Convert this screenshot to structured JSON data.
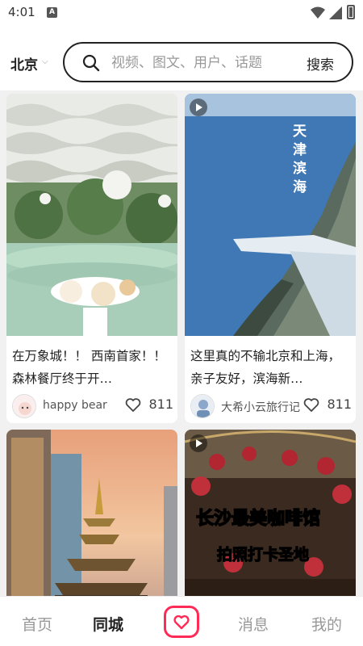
{
  "status_bar": {
    "time": "4:01",
    "notif_icon_letter": "A"
  },
  "header": {
    "city": "北京",
    "search_placeholder": "视频、图文、用户、话题",
    "search_button": "搜索"
  },
  "feed": {
    "cards": [
      {
        "title": "在万象城！！ 西南首家！！ 森林餐厅终于开…",
        "author": "happy bear",
        "likes": "811",
        "is_video": false,
        "image": "forest-restaurant"
      },
      {
        "title": "这里真的不输北京和上海，亲子友好，滨海新…",
        "author": "大希小云旅行记",
        "likes": "811",
        "is_video": true,
        "image": "tianjin-coast",
        "image_text": "天津滨海"
      },
      {
        "title": "",
        "author": "",
        "likes": "",
        "is_video": false,
        "image": "pagoda-sunset"
      },
      {
        "title": "",
        "author": "",
        "likes": "",
        "is_video": true,
        "image": "changsha-cafe",
        "image_text_1": "长沙最美咖啡馆",
        "image_text_2": "拍照打卡圣地"
      }
    ]
  },
  "nav": {
    "tabs": [
      "首页",
      "同城",
      "消息",
      "我的"
    ],
    "active": "同城"
  },
  "colors": {
    "accent": "#ff2a55"
  }
}
